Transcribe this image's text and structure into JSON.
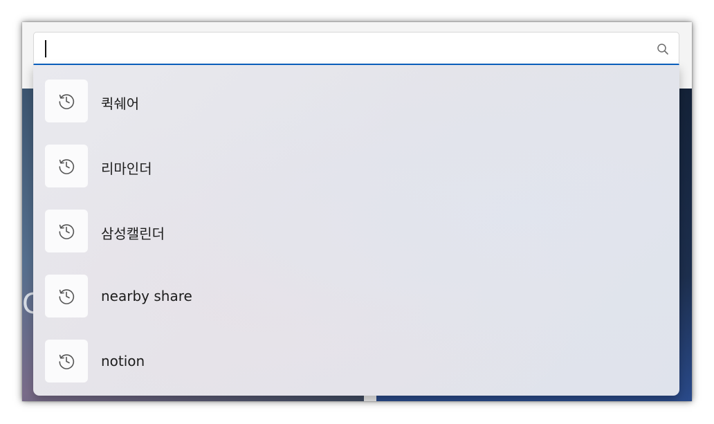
{
  "search": {
    "value": "",
    "placeholder": "",
    "icon": "search-icon"
  },
  "history": {
    "icon": "history-icon",
    "items": [
      {
        "label": "퀵쉐어"
      },
      {
        "label": "리마인더"
      },
      {
        "label": "삼성캘린더"
      },
      {
        "label": "nearby share"
      },
      {
        "label": "notion"
      }
    ]
  },
  "background": {
    "letter": "G"
  },
  "colors": {
    "accent": "#0b62c3",
    "flyout": "#e6e7ec",
    "tile": "#fbfbfc"
  }
}
